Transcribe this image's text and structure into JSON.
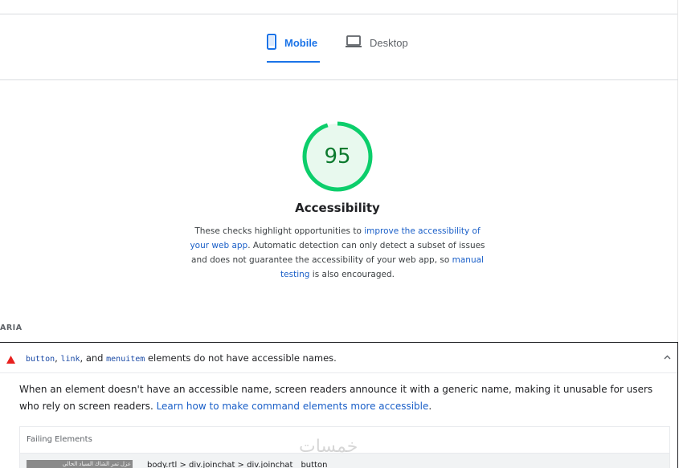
{
  "tabs": [
    {
      "label": "Mobile",
      "icon": "mobile-phone-icon",
      "active": true
    },
    {
      "label": "Desktop",
      "icon": "laptop-icon",
      "active": false
    }
  ],
  "category": {
    "score": "95",
    "title": "Accessibility",
    "description_pre": "These checks highlight opportunities to ",
    "description_link1": "improve the accessibility of your web app",
    "description_mid": ". Automatic detection can only detect a subset of issues and does not guarantee the accessibility of your web app, so ",
    "description_link2": "manual testing",
    "description_post": " is also encouraged.",
    "score_color": "#0cce6b"
  },
  "group": {
    "label": "ARIA"
  },
  "audit": {
    "code1": "button",
    "sep1": ", ",
    "code2": "link",
    "sep2": ", and ",
    "code3": "menuitem",
    "title_rest": " elements do not have accessible names.",
    "body_text": "When an element doesn't have an accessible name, screen readers announce it with a generic name, making it unusable for users who rely on screen readers. ",
    "learn_link": "Learn how to make command elements more accessible",
    "body_end": ".",
    "table_header": "Failing Elements",
    "thumb_text": "عزل تمر الشاك السياد الحالي",
    "node_path": "body.rtl > div.joinchat > div.joinchat__button"
  },
  "watermark": "خمسات"
}
